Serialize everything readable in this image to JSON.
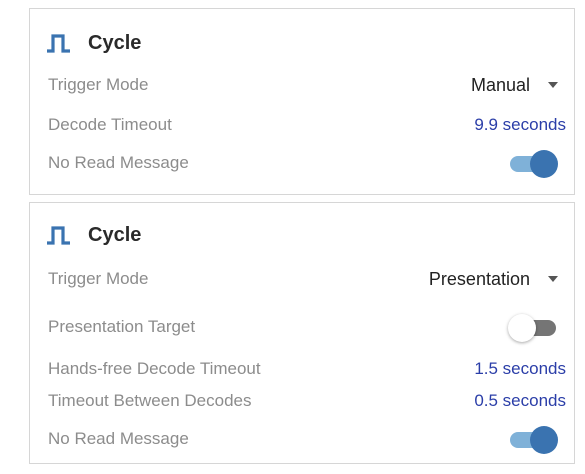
{
  "colors": {
    "accent": "#3a73b0",
    "link_value": "#2b3ea8",
    "label_gray": "#8c8c8c",
    "toggle_on_track": "#7fb1d8",
    "toggle_off_track": "#757575"
  },
  "panels": [
    {
      "icon": "square-wave-icon",
      "title": "Cycle",
      "trigger_mode": {
        "label": "Trigger Mode",
        "value": "Manual"
      },
      "decode_timeout": {
        "label": "Decode Timeout",
        "value": "9.9 seconds"
      },
      "no_read_message": {
        "label": "No Read Message",
        "on": true
      }
    },
    {
      "icon": "square-wave-icon",
      "title": "Cycle",
      "trigger_mode": {
        "label": "Trigger Mode",
        "value": "Presentation"
      },
      "presentation_target": {
        "label": "Presentation Target",
        "on": false
      },
      "hands_free_decode_timeout": {
        "label": "Hands-free Decode Timeout",
        "value": "1.5 seconds"
      },
      "timeout_between_decodes": {
        "label": "Timeout Between Decodes",
        "value": "0.5 seconds"
      },
      "no_read_message": {
        "label": "No Read Message",
        "on": true
      }
    }
  ]
}
